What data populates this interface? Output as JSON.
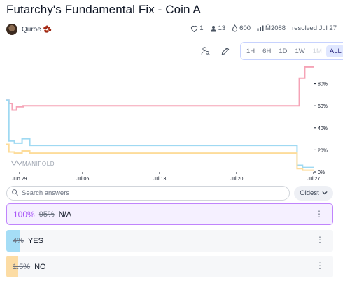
{
  "title": "Futarchy's Fundamental Fix - Coin A",
  "creator": {
    "name": "Quroe",
    "emoji": "🫘"
  },
  "stats": {
    "likes": "1",
    "traders": "13",
    "bounty": "600",
    "volume": "Ṁ2088",
    "status": "resolved Jul 27"
  },
  "time_ranges": [
    "1H",
    "6H",
    "1D",
    "1W",
    "1M",
    "ALL"
  ],
  "time_range_selected": "ALL",
  "time_range_disabled": [
    "1M"
  ],
  "watermark": "MANIFOLD",
  "chart_data": {
    "type": "line",
    "x_ticks": [
      "Jun 29",
      "Jul 06",
      "Jul 13",
      "Jul 20",
      "Jul 27"
    ],
    "y_ticks": [
      "0%",
      "20%",
      "40%",
      "60%",
      "80%"
    ],
    "ylim": [
      0,
      1
    ],
    "series": [
      {
        "name": "N/A",
        "color": "#f5a3b6",
        "x": [
          0,
          0.3,
          0.6,
          1.0,
          1.6,
          2.0,
          26.5,
          26.7,
          27.2,
          28.0
        ],
        "y": [
          0.65,
          0.62,
          0.56,
          0.59,
          0.6,
          0.6,
          0.6,
          0.85,
          0.95,
          0.95
        ]
      },
      {
        "name": "YES",
        "color": "#9fd9f2",
        "x": [
          0,
          0.3,
          0.8,
          1.5,
          2.2,
          26.2,
          26.5,
          27.0,
          28.0
        ],
        "y": [
          0.65,
          0.28,
          0.26,
          0.3,
          0.24,
          0.24,
          0.06,
          0.04,
          0.04
        ]
      },
      {
        "name": "NO",
        "color": "#fddc9a",
        "x": [
          0,
          0.3,
          0.8,
          1.5,
          2.2,
          26.2,
          26.5,
          27.0,
          28.0
        ],
        "y": [
          0.25,
          0.18,
          0.17,
          0.19,
          0.17,
          0.17,
          0.03,
          0.015,
          0.015
        ]
      }
    ]
  },
  "search": {
    "placeholder": "Search answers"
  },
  "sort": {
    "label": "Oldest"
  },
  "answers": [
    {
      "resolved_pct": "100%",
      "prob": "95%",
      "label": "N/A"
    },
    {
      "prob": "4%",
      "label": "YES",
      "color": "#a5ddf6",
      "fill": 0.04
    },
    {
      "prob": "1.5%",
      "label": "NO",
      "color": "#fcdca4",
      "fill": 0.015
    }
  ]
}
